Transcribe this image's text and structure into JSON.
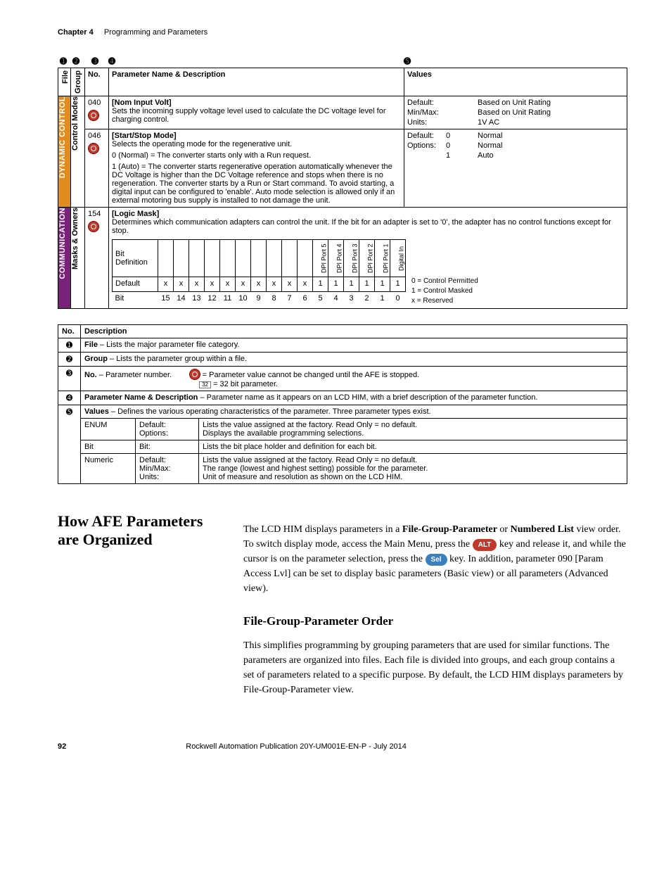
{
  "header": {
    "chapter": "Chapter 4",
    "title": "Programming and Parameters"
  },
  "col_callouts": [
    "➊",
    "➋",
    "➌",
    "➍",
    "➎"
  ],
  "main_table": {
    "headers": {
      "file": "File",
      "group": "Group",
      "no": "No.",
      "name": "Parameter Name & Description",
      "values": "Values"
    },
    "file1": "DYNAMIC CONTROL",
    "group1": "Control Modes",
    "file2": "COMMUNICATION",
    "group2": "Masks & Owners",
    "row_040": {
      "no": "040",
      "name": "[Nom Input Volt]",
      "desc": "Sets the incoming supply voltage level used to calculate the DC voltage level for charging control.",
      "vals": {
        "default_l": "Default:",
        "default_v": "Based on Unit Rating",
        "minmax_l": "Min/Max:",
        "minmax_v": "Based on Unit Rating",
        "units_l": "Units:",
        "units_v": "1V AC"
      }
    },
    "row_046": {
      "no": "046",
      "name": "[Start/Stop Mode]",
      "d1": "Selects the operating mode for the regenerative unit.",
      "d2": "0 (Normal) = The converter starts only with a Run request.",
      "d3": "1 (Auto) = The converter starts regenerative operation automatically whenever the DC Voltage is higher than the DC Voltage reference and stops when there is no regeneration. The converter starts by a Run or Start command. To avoid starting, a digital input can be configured to 'enable'. Auto mode selection is allowed only if an external motoring bus supply is installed to not damage the unit.",
      "vals": {
        "default_l": "Default:",
        "default_n": "0",
        "default_t": "Normal",
        "options_l": "Options:",
        "o0n": "0",
        "o0t": "Normal",
        "o1n": "1",
        "o1t": "Auto"
      }
    },
    "row_154": {
      "no": "154",
      "name": "[Logic Mask]",
      "desc": "Determines which communication adapters can control the unit. If the bit for an adapter is set to '0', the adapter has no control functions except for stop.",
      "bits": {
        "def_label": "Bit Definition",
        "named": [
          "DPI Port 5",
          "DPI Port 4",
          "DPI Port 3",
          "DPI Port 2",
          "DPI Port 1",
          "Digital In"
        ],
        "default_row": "Default",
        "default_vals_x": [
          "x",
          "x",
          "x",
          "x",
          "x",
          "x",
          "x",
          "x",
          "x",
          "x"
        ],
        "default_vals_1": [
          "1",
          "1",
          "1",
          "1",
          "1",
          "1"
        ],
        "bit_row": "Bit",
        "bit_nums": [
          "15",
          "14",
          "13",
          "12",
          "11",
          "10",
          "9",
          "8",
          "7",
          "6",
          "5",
          "4",
          "3",
          "2",
          "1",
          "0"
        ],
        "legend0": "0 = Control Permitted",
        "legend1": "1 = Control Masked",
        "legendx": "x = Reserved"
      }
    }
  },
  "key_table": {
    "h_no": "No.",
    "h_desc": "Description",
    "r1": {
      "t": "File",
      "d": " – Lists the major parameter file category."
    },
    "r2": {
      "t": "Group",
      "d": " – Lists the parameter group within a file."
    },
    "r3": {
      "t": "No.",
      "d": " – Parameter number.",
      "icon_d": " = Parameter value cannot be changed until the AFE is stopped.",
      "p32": " = 32 bit parameter."
    },
    "r4": {
      "t": "Parameter Name & Description",
      "d": " – Parameter name as it appears on an LCD HIM, with a brief description of the parameter function."
    },
    "r5": {
      "t": "Values",
      "d": " – Defines the various operating characteristics of the parameter. Three parameter types exist."
    },
    "enum": {
      "l": "ENUM",
      "c1": "Default:",
      "c1d": "Lists the value assigned at the factory. Read Only = no default.",
      "c2": "Options:",
      "c2d": "Displays the available programming selections."
    },
    "bit": {
      "l": "Bit",
      "c1": "Bit:",
      "c1d": "Lists the bit place holder and definition for each bit."
    },
    "num": {
      "l": "Numeric",
      "c1": "Default:",
      "c1d": "Lists the value assigned at the factory. Read Only = no default.",
      "c2": "Min/Max:",
      "c2d": "The range (lowest and highest setting) possible for the parameter.",
      "c3": "Units:",
      "c3d": "Unit of measure and resolution as shown on the LCD HIM."
    }
  },
  "article": {
    "h1": "How AFE Parameters are Organized",
    "p1a": "The LCD HIM displays parameters in a ",
    "p1b": "File-Group-Parameter",
    "p1c": " or ",
    "p1d": "Numbered List",
    "p1e": " view order. To switch display mode, access the Main Menu, press the ",
    "alt": "ALT",
    "p1f": " key and release it, and while the cursor is on the parameter selection, press the ",
    "sel": "Sel",
    "p1g": " key. In addition, parameter 090 [Param Access Lvl] can be set to display basic parameters (Basic view) or all parameters (Advanced view).",
    "h2": "File-Group-Parameter Order",
    "p2": "This simplifies programming by grouping parameters that are used for similar functions. The parameters are organized into files. Each file is divided into groups, and each group contains a set of parameters related to a specific purpose. By default, the LCD HIM displays parameters by File-Group-Parameter view."
  },
  "footer": {
    "page": "92",
    "pub": "Rockwell Automation Publication 20Y-UM001E-EN-P - July 2014"
  }
}
